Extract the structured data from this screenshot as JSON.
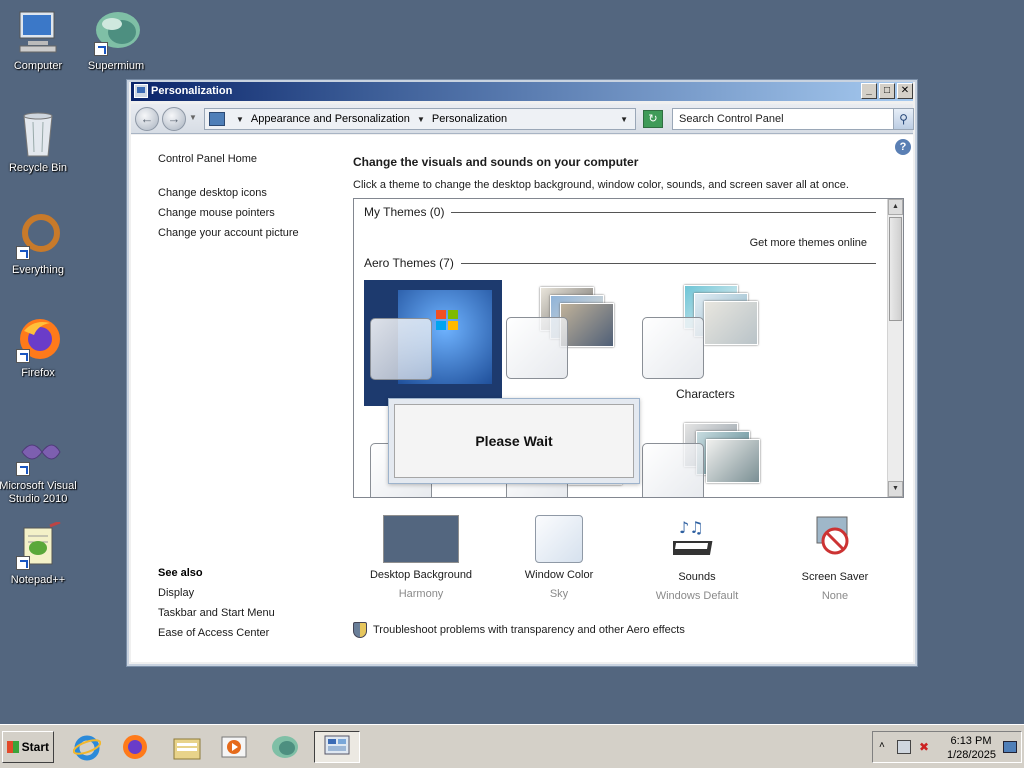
{
  "desktop": {
    "icons": [
      {
        "label": "Computer"
      },
      {
        "label": "Supermium"
      },
      {
        "label": "Recycle Bin"
      },
      {
        "label": "Everything"
      },
      {
        "label": "Firefox"
      },
      {
        "label": "Microsoft Visual Studio 2010"
      },
      {
        "label": "Notepad++"
      }
    ]
  },
  "window": {
    "title": "Personalization",
    "buttons": {
      "minimize": "_",
      "maximize": "□",
      "close": "✕"
    }
  },
  "address": {
    "crumbs": [
      "Appearance and Personalization",
      "Personalization"
    ],
    "search_placeholder": "Search Control Panel"
  },
  "left_nav": {
    "home": "Control Panel Home",
    "links": [
      "Change desktop icons",
      "Change mouse pointers",
      "Change your account picture"
    ]
  },
  "see_also": {
    "heading": "See also",
    "links": [
      "Display",
      "Taskbar and Start Menu",
      "Ease of Access Center"
    ]
  },
  "main": {
    "title": "Change the visuals and sounds on your computer",
    "subtitle": "Click a theme to change the desktop background, window color, sounds, and screen saver all at once."
  },
  "themes": {
    "my_themes": "My Themes (0)",
    "get_more": "Get more themes online",
    "aero_themes": "Aero Themes (7)",
    "visible_labels": [
      "Characters"
    ]
  },
  "dialog": {
    "text": "Please Wait"
  },
  "bottom": [
    {
      "label": "Desktop Background",
      "value": "Harmony"
    },
    {
      "label": "Window Color",
      "value": "Sky"
    },
    {
      "label": "Sounds",
      "value": "Windows Default"
    },
    {
      "label": "Screen Saver",
      "value": "None"
    }
  ],
  "troubleshoot": "Troubleshoot problems with transparency and other Aero effects",
  "taskbar": {
    "start": "Start",
    "time": "6:13 PM",
    "date": "1/28/2025"
  },
  "colors": {
    "desktop": "#53667f",
    "taskbar": "#d4d0c8"
  }
}
